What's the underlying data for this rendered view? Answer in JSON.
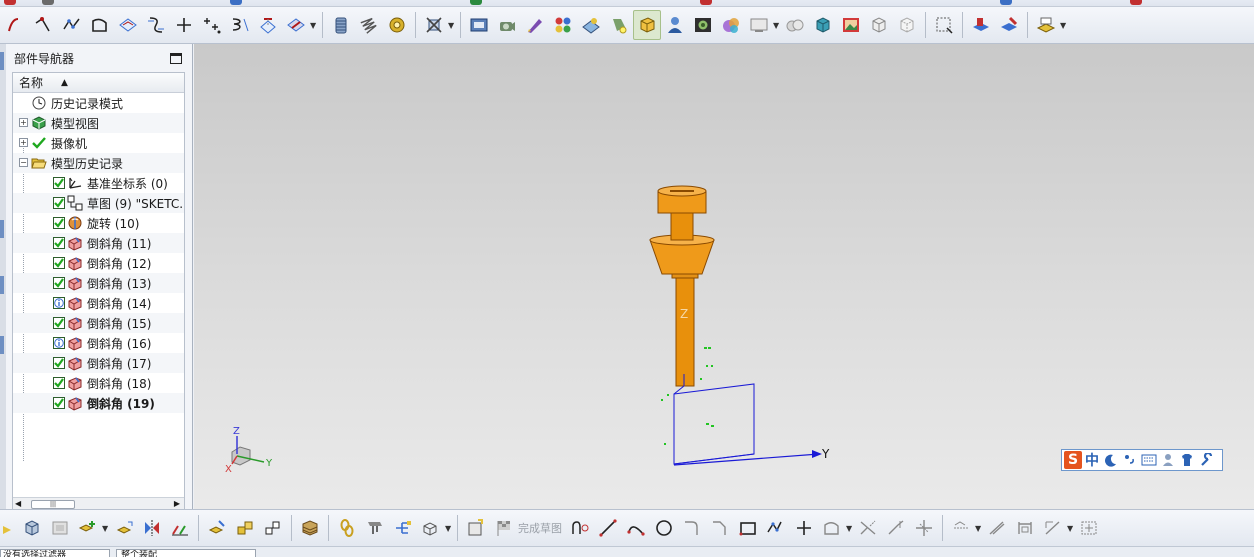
{
  "navigator": {
    "title": "部件导航器",
    "column_name": "名称",
    "items": [
      {
        "label": "历史记录模式",
        "icon": "clock-icon",
        "level": 0,
        "expander": ""
      },
      {
        "label": "模型视图",
        "icon": "model-views-icon",
        "level": 0,
        "expander": "+"
      },
      {
        "label": "摄像机",
        "icon": "camera-icon",
        "level": 0,
        "expander": "+"
      },
      {
        "label": "模型历史记录",
        "icon": "folder-open-icon",
        "level": 0,
        "expander": "-"
      },
      {
        "label": "基准坐标系 (0)",
        "icon": "datum-csys-icon",
        "level": 1,
        "checked": true
      },
      {
        "label": "草图 (9) \"SKETC...",
        "icon": "sketch-icon",
        "level": 1,
        "checked": true
      },
      {
        "label": "旋转 (10)",
        "icon": "revolve-icon",
        "level": 1,
        "checked": true
      },
      {
        "label": "倒斜角 (11)",
        "icon": "chamfer-icon",
        "level": 1,
        "checked": true
      },
      {
        "label": "倒斜角 (12)",
        "icon": "chamfer-icon",
        "level": 1,
        "checked": true
      },
      {
        "label": "倒斜角 (13)",
        "icon": "chamfer-icon",
        "level": 1,
        "checked": true
      },
      {
        "label": "倒斜角 (14)",
        "icon": "chamfer-icon",
        "level": 1,
        "checked": true,
        "info": true
      },
      {
        "label": "倒斜角 (15)",
        "icon": "chamfer-icon",
        "level": 1,
        "checked": true
      },
      {
        "label": "倒斜角 (16)",
        "icon": "chamfer-icon",
        "level": 1,
        "checked": true,
        "info": true
      },
      {
        "label": "倒斜角 (17)",
        "icon": "chamfer-icon",
        "level": 1,
        "checked": true
      },
      {
        "label": "倒斜角 (18)",
        "icon": "chamfer-icon",
        "level": 1,
        "checked": true
      },
      {
        "label": "倒斜角 (19)",
        "icon": "chamfer-icon",
        "level": 1,
        "checked": true,
        "bold": true
      }
    ]
  },
  "viewport": {
    "axis_labels": {
      "z": "Z",
      "y": "Y",
      "x": "X"
    },
    "model_color": "#e8900c",
    "wcs_color": "#1a1ad6"
  },
  "ime_bar": {
    "logo": "S",
    "mode_label": "中"
  },
  "bottom_toolbar": {
    "finish_sketch_label": "完成草图"
  },
  "status_strip": {
    "filter_label": "没有选择过滤器",
    "assembly_label": "整个装配"
  },
  "colors": {
    "accent_blue": "#2c63b5",
    "check_green": "#1fa81f",
    "toolbar_bg": "#e3e8f0"
  }
}
